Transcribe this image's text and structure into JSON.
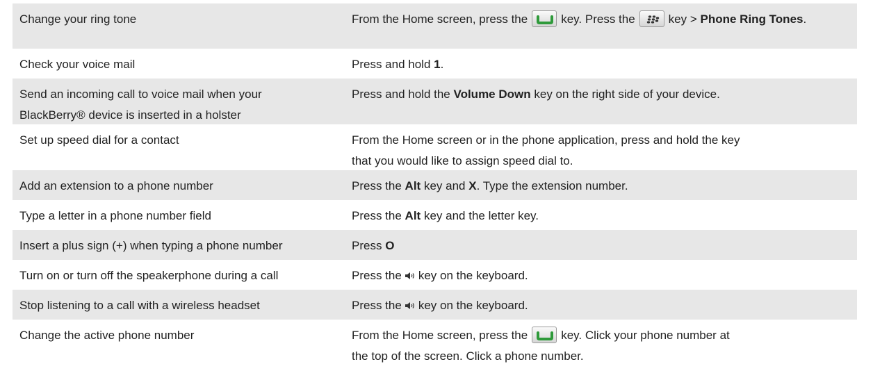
{
  "rows": [
    {
      "task": "Change your ring tone",
      "action": {
        "t1": "From the Home screen, press the",
        "t2": "key. Press the",
        "t3": "key >",
        "b1": "Phone Ring Tones",
        "t4": "."
      }
    },
    {
      "task": "Check your voice mail",
      "action": {
        "t1": "Press and hold",
        "b1": "1",
        "t2": "."
      }
    },
    {
      "task_line1": "Send an incoming call to voice mail when your",
      "task_line2": "BlackBerry® device is inserted in a holster",
      "action": {
        "t1": "Press and hold the",
        "b1": "Volume Down",
        "t2": "key on the right side of your device."
      }
    },
    {
      "task": "Set up speed dial for a contact",
      "action": {
        "line1": "From the Home screen or in the phone application, press and hold the key",
        "line2": "that you would like to assign speed dial to."
      }
    },
    {
      "task": "Add an extension to a phone number",
      "action": {
        "t1": "Press the",
        "b1": "Alt",
        "t2": "key and",
        "b2": "X",
        "t3": ". Type the extension number."
      }
    },
    {
      "task": "Type a letter in a phone number field",
      "action": {
        "t1": "Press the",
        "b1": "Alt",
        "t2": "key and the letter key."
      }
    },
    {
      "task": "Insert a plus sign (+) when typing a phone number",
      "action": {
        "t1": "Press",
        "b1": "O"
      }
    },
    {
      "task": "Turn on or turn off the speakerphone during a call",
      "action": {
        "t1": "Press the",
        "t2": "key on the keyboard."
      }
    },
    {
      "task": "Stop listening to a call with a wireless headset",
      "action": {
        "t1": "Press the",
        "t2": "key on the keyboard."
      }
    },
    {
      "task": "Change the active phone number",
      "action": {
        "t1": "From the Home screen, press the",
        "t2": "key. Click your phone number at",
        "line2": "the top of the screen. Click a phone number."
      }
    }
  ],
  "icons": {
    "send_key": "phone-send-key-icon",
    "menu_key": "blackberry-menu-key-icon",
    "speaker_key": "speaker-key-icon"
  },
  "colors": {
    "shaded_row": "#e7e7e7",
    "send_key_green": "#2e9a3a",
    "menu_key_dark": "#333333"
  }
}
